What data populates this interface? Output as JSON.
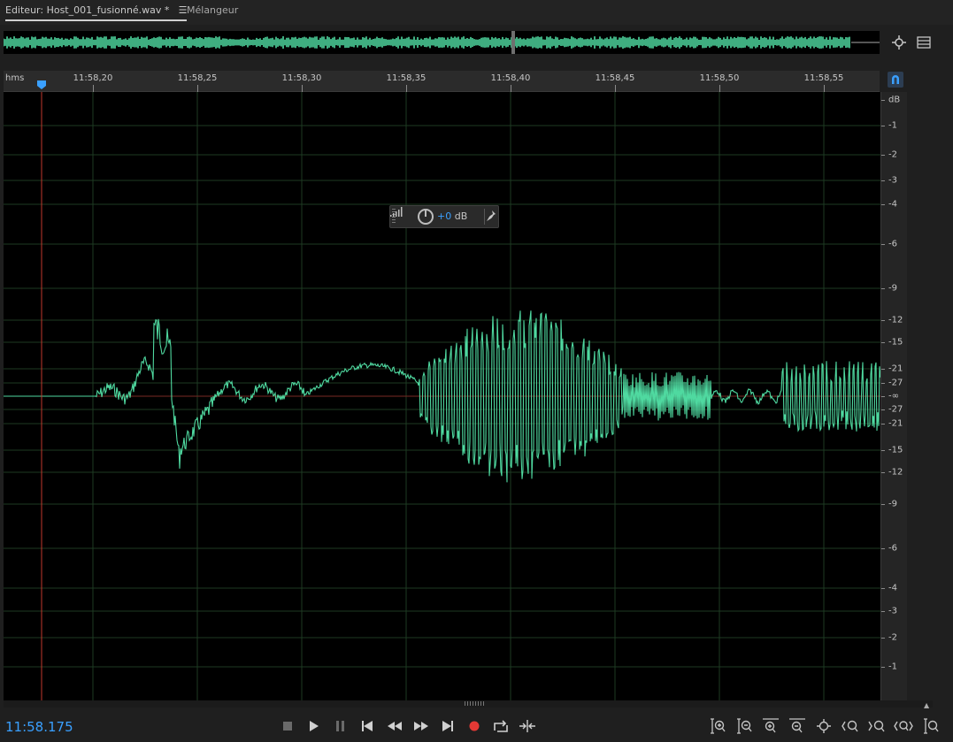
{
  "tabs": {
    "editor_label": "Editeur: Host_001_fusionné.wav *",
    "editor_menu": "☰",
    "mixer_label": "Mélangeur"
  },
  "ruler": {
    "unit": "hms",
    "ticks": [
      "11:58,20",
      "11:58,25",
      "11:58,30",
      "11:58,35",
      "11:58,40",
      "11:58,45",
      "11:58,50",
      "11:58,55"
    ]
  },
  "db_scale": {
    "unit": "dB",
    "upper": [
      "-1",
      "-2",
      "-3",
      "-4",
      "-6",
      "-9",
      "-12",
      "-15",
      "-21",
      "-27"
    ],
    "center": "-∞",
    "lower": [
      "-27",
      "-21",
      "-15",
      "-12",
      "-9",
      "-6",
      "-4",
      "-3",
      "-2",
      "-1"
    ]
  },
  "hud": {
    "value": "+0",
    "unit": "dB"
  },
  "transport": {
    "current_time": "11:58.175"
  },
  "colors": {
    "waveform": "#4fd9a0",
    "time_display": "#3aa0ff",
    "playhead": "#c0392b",
    "grid": "#1e3a22"
  },
  "icons": {
    "overview_zoom": "zoom-nav-icon",
    "overview_menu": "list-icon",
    "snap": "magnet-icon",
    "stop": "stop-icon",
    "play": "play-icon",
    "pause": "pause-icon",
    "to_start": "skip-start-icon",
    "rewind": "rewind-icon",
    "fast_forward": "fast-forward-icon",
    "to_end": "skip-end-icon",
    "record": "record-icon",
    "loop": "loop-icon",
    "skip_selection": "skip-selection-icon"
  }
}
